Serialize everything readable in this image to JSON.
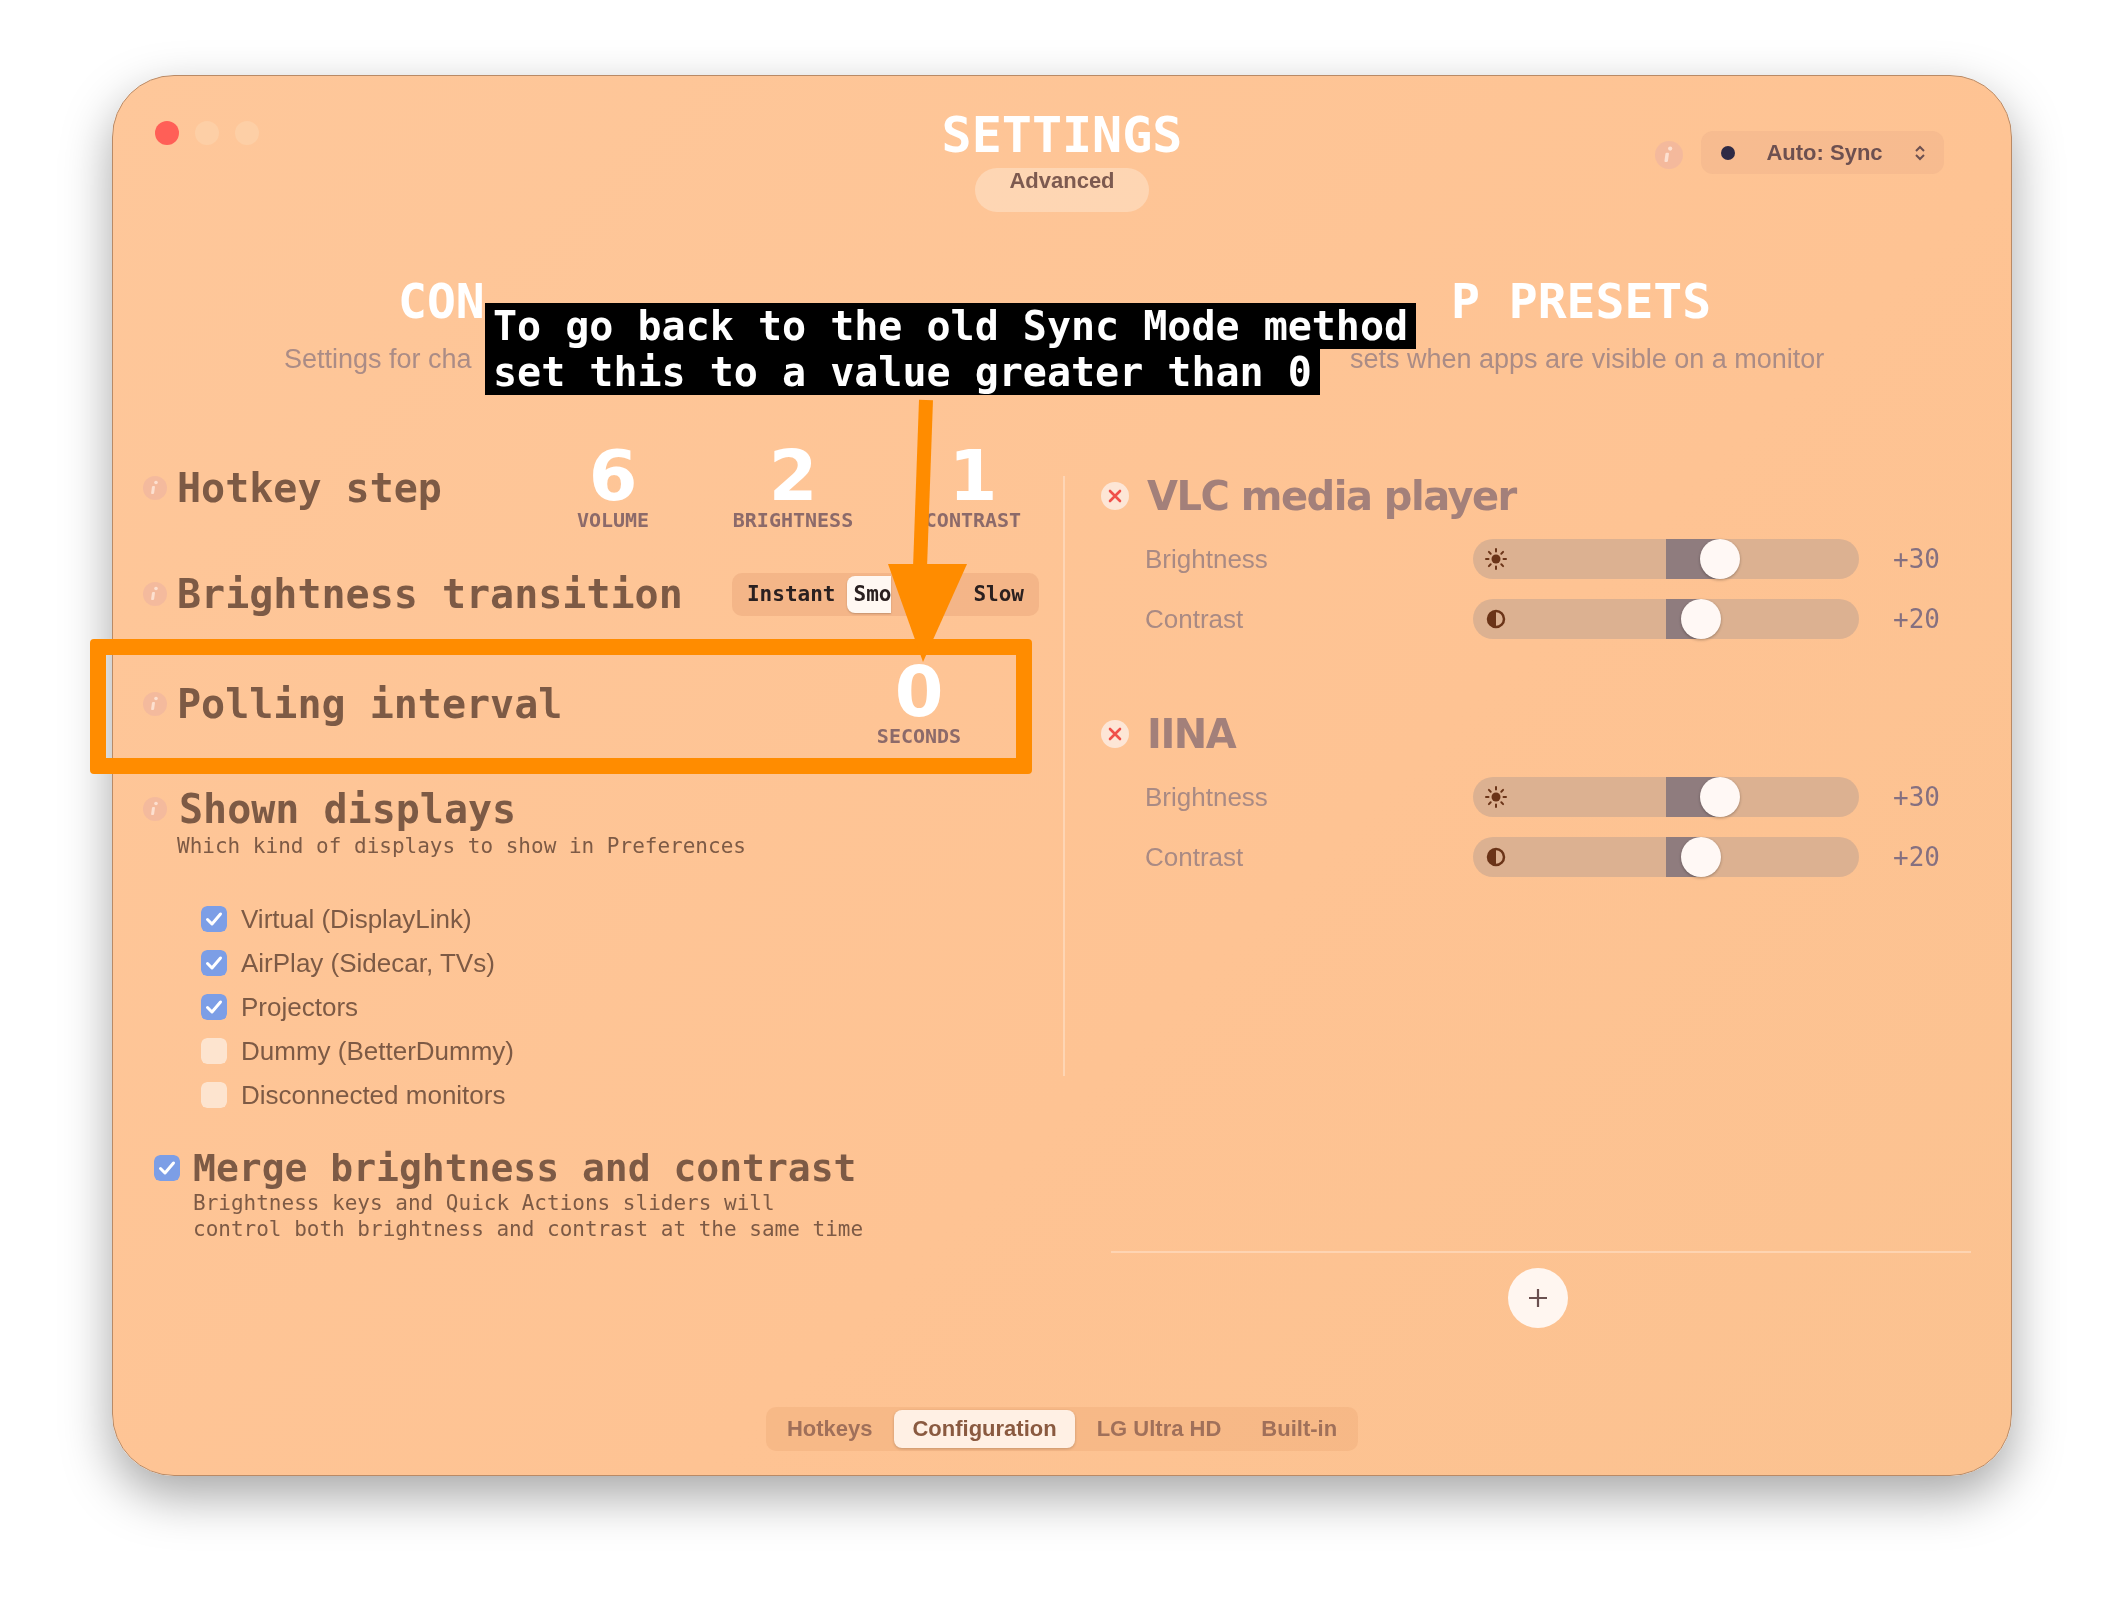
{
  "window": {
    "title": "SETTINGS",
    "badge": "Advanced"
  },
  "traffic_lights": [
    {
      "color": "#ff5f57"
    },
    {
      "color": "#fdcfa6"
    },
    {
      "color": "#fdcfa6"
    }
  ],
  "sync_mode": {
    "label": "Auto: Sync"
  },
  "configuration": {
    "heading": "CON",
    "description": "Settings for cha",
    "settings": [
      {
        "kind": "steps",
        "label": "Hotkey step",
        "values": [
          {
            "value": "6",
            "caption": "VOLUME"
          },
          {
            "value": "2",
            "caption": "BRIGHTNESS"
          },
          {
            "value": "1",
            "caption": "CONTRAST"
          }
        ]
      },
      {
        "kind": "segmented",
        "label": "Brightness transition",
        "options": [
          {
            "label": "Instant",
            "selected": false
          },
          {
            "label": "Smo",
            "selected": true
          },
          {
            "label": "Slow",
            "selected": false
          }
        ]
      },
      {
        "kind": "number",
        "label": "Polling interval",
        "value": "0",
        "unit": "SECONDS"
      },
      {
        "kind": "checklist",
        "label": "Shown displays",
        "description": "Which kind of displays to show in Preferences",
        "items": [
          {
            "label": "Virtual (DisplayLink)",
            "checked": true
          },
          {
            "label": "AirPlay (Sidecar, TVs)",
            "checked": true
          },
          {
            "label": "Projectors",
            "checked": true
          },
          {
            "label": "Dummy (BetterDummy)",
            "checked": false
          },
          {
            "label": "Disconnected monitors",
            "checked": false
          }
        ]
      },
      {
        "kind": "toggle",
        "label": "Merge brightness and contrast",
        "checked": true,
        "description": "Brightness keys and Quick Actions sliders will\ncontrol both brightness and contrast at the same time"
      }
    ]
  },
  "app_presets": {
    "heading": "P PRESETS",
    "description": "sets when apps are visible on a monitor",
    "apps": [
      {
        "name": "VLC media player",
        "controls": [
          {
            "label": "Brightness",
            "kind": "brightness",
            "level": 0.64,
            "reading": "+30"
          },
          {
            "label": "Contrast",
            "kind": "contrast",
            "level": 0.59,
            "reading": "+20"
          }
        ]
      },
      {
        "name": "IINA",
        "controls": [
          {
            "label": "Brightness",
            "kind": "brightness",
            "level": 0.64,
            "reading": "+30"
          },
          {
            "label": "Contrast",
            "kind": "contrast",
            "level": 0.59,
            "reading": "+20"
          }
        ]
      }
    ]
  },
  "tabs": [
    {
      "label": "Hotkeys",
      "selected": false
    },
    {
      "label": "Configuration",
      "selected": true
    },
    {
      "label": "LG Ultra HD",
      "selected": false
    },
    {
      "label": "Built-in",
      "selected": false
    }
  ],
  "annotation": {
    "lines": [
      "To go back to the old Sync Mode method",
      "set this to a value greater than 0"
    ]
  }
}
